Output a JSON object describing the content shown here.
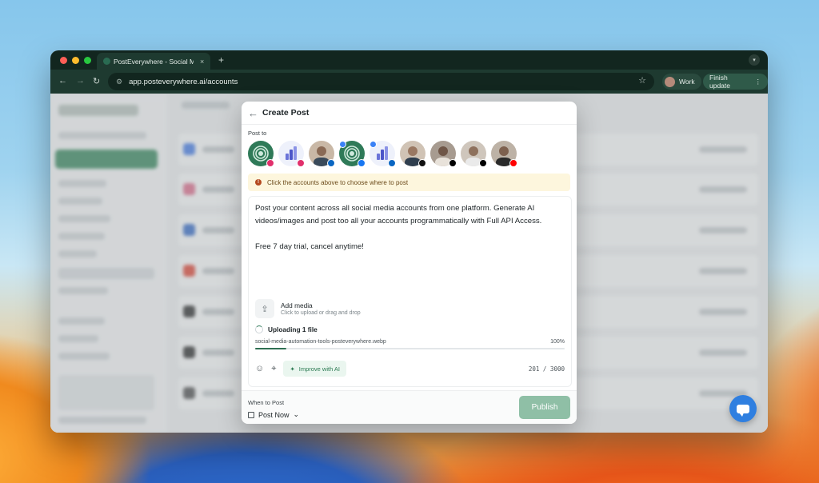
{
  "browser": {
    "tab_title": "PostEverywhere - Social Med",
    "tab_close": "×",
    "new_tab": "+",
    "url": "app.posteverywhere.ai/accounts",
    "profile_label": "Work",
    "finish_update_label": "Finish update"
  },
  "modal": {
    "title": "Create Post",
    "post_to_label": "Post to",
    "notice": "Click the accounts above to choose where to post",
    "body": "Post your content across all social media accounts from one platform. Generate AI videos/images and post too all your accounts programmatically with Full API Access.\n\nFree 7 day trial, cancel anytime!",
    "add_media_title": "Add media",
    "add_media_sub": "Click to upload or drag and drop",
    "uploading_label": "Uploading 1 file",
    "file_name": "social-media-automation-tools-posteverywhere.webp",
    "file_progress": "100%",
    "progress_fraction": 0.1,
    "improve_label": "Improve with AI",
    "char_count": "201 / 3000",
    "when_to_post_label": "When to Post",
    "post_now_label": "Post Now",
    "publish_label": "Publish"
  },
  "accounts": [
    {
      "icon": "logo-green",
      "platform": "instagram"
    },
    {
      "icon": "logo-bars",
      "platform": "instagram"
    },
    {
      "icon": "person-avatar",
      "platform": "linkedin"
    },
    {
      "icon": "logo-green",
      "platform": "facebook",
      "tagged": true
    },
    {
      "icon": "logo-bars",
      "platform": "linkedin",
      "tagged": true
    },
    {
      "icon": "person-avatar",
      "platform": "threads"
    },
    {
      "icon": "person-avatar",
      "platform": "tiktok"
    },
    {
      "icon": "person-avatar",
      "platform": "x"
    },
    {
      "icon": "person-avatar",
      "platform": "youtube"
    }
  ],
  "colors": {
    "brand_green": "#2f7a58",
    "publish_disabled": "#8fbfa6",
    "notice_bg": "#fdf6dd",
    "chat_blue": "#2f7fe0"
  }
}
